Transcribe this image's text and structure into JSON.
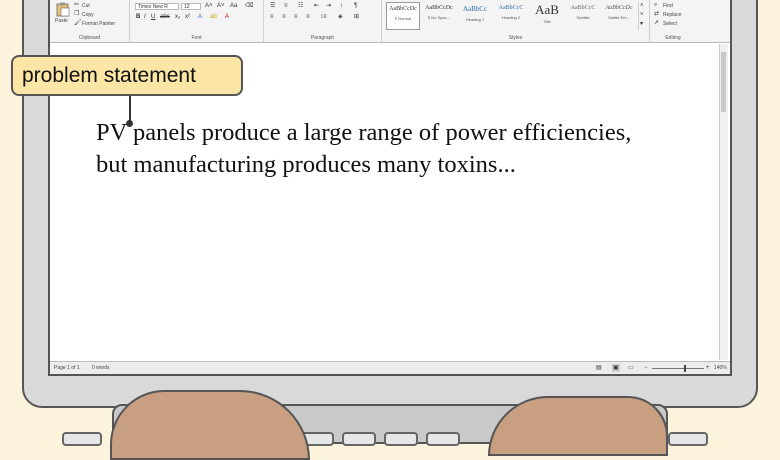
{
  "ribbon": {
    "clipboard": {
      "paste": "Paste",
      "cut": "Cut",
      "copy": "Copy",
      "format_painter": "Format Painter",
      "label": "Clipboard"
    },
    "font": {
      "family": "Times New R",
      "size": "12",
      "label": "Font"
    },
    "paragraph": {
      "label": "Paragraph"
    },
    "styles": {
      "label": "Styles",
      "items": [
        {
          "preview": "AaBbCcDc",
          "name": "¶ Normal"
        },
        {
          "preview": "AaBbCcDc",
          "name": "¶ No Spac..."
        },
        {
          "preview": "AaBbCc",
          "name": "Heading 1"
        },
        {
          "preview": "AaBbCcC",
          "name": "Heading 2"
        },
        {
          "preview": "AaB",
          "name": "Title"
        },
        {
          "preview": "AaBbCcC",
          "name": "Subtitle"
        },
        {
          "preview": "AaBbCcDc",
          "name": "Subtle Em..."
        }
      ]
    },
    "editing": {
      "find": "Find",
      "replace": "Replace",
      "select": "Select",
      "label": "Editing"
    }
  },
  "document": {
    "body_lines": [
      "PV panels produce a large range of power efficiencies,",
      "but manufacturing produces many toxins..."
    ]
  },
  "status_bar": {
    "page": "Page 1 of 1",
    "words": "0 words",
    "zoom": "140%"
  },
  "annotation": {
    "label": "problem statement"
  },
  "colors": {
    "callout_fill": "#fbe6a6",
    "background": "#fbf3dc",
    "skin": "#c99f82"
  }
}
